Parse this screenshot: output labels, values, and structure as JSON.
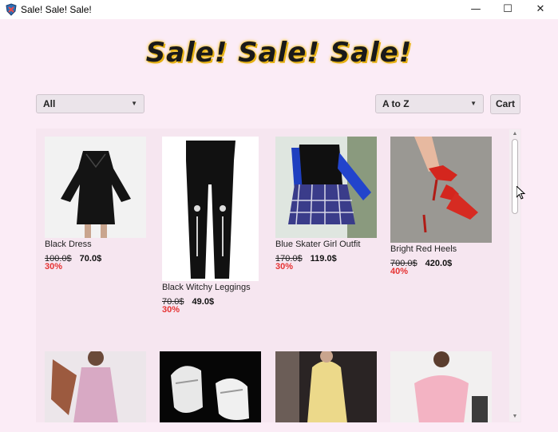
{
  "window": {
    "title": "Sale! Sale! Sale!",
    "minimize": "—",
    "maximize": "☐",
    "close": "✕"
  },
  "heading": "Sale! Sale! Sale!",
  "filters": {
    "category_selected": "All",
    "sort_selected": "A to Z",
    "cart_label": "Cart"
  },
  "products": [
    {
      "name": "Black Dress",
      "old_price": "100.0$",
      "new_price": "70.0$",
      "discount": "30%"
    },
    {
      "name": "Black Witchy Leggings",
      "old_price": "70.0$",
      "new_price": "49.0$",
      "discount": "30%"
    },
    {
      "name": "Blue Skater Girl Outfit",
      "old_price": "170.0$",
      "new_price": "119.0$",
      "discount": "30%"
    },
    {
      "name": "Bright Red Heels",
      "old_price": "700.0$",
      "new_price": "420.0$",
      "discount": "40%"
    }
  ],
  "colors": {
    "background": "#fbecf6",
    "discount": "#e63232",
    "heading_glow": "#f4c21e"
  },
  "icons": {
    "app": "shield-app-icon",
    "dropdown": "chevron-down-icon"
  }
}
